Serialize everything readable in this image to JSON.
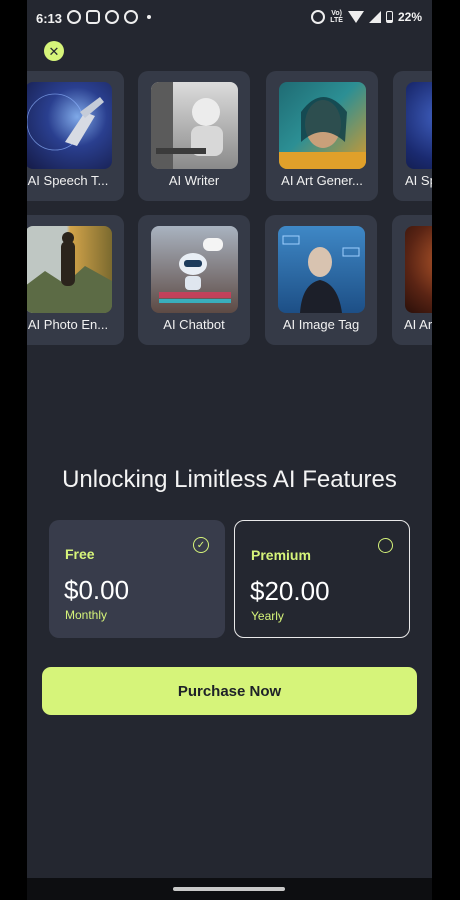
{
  "status_bar": {
    "time": "6:13",
    "left_icons": [
      "whatsapp-icon",
      "instagram-icon",
      "app-icon",
      "app-icon",
      "notification-dot"
    ],
    "network_label_top": "Vo)",
    "network_label_bottom": "LTE",
    "battery": "22%"
  },
  "close_button": {
    "icon": "close-icon",
    "glyph": "✕"
  },
  "tools_row1": [
    {
      "label": "AI Speech T...",
      "icon": "speech-robot-image"
    },
    {
      "label": "AI Writer",
      "icon": "writer-robot-image"
    },
    {
      "label": "AI Art Gener...",
      "icon": "art-portrait-image"
    },
    {
      "label": "AI Sp",
      "icon": "speech-image"
    }
  ],
  "tools_row2": [
    {
      "label": "AI Photo En...",
      "icon": "photo-enhance-image"
    },
    {
      "label": "AI Chatbot",
      "icon": "chatbot-image"
    },
    {
      "label": "AI Image Tag",
      "icon": "image-tag-image"
    },
    {
      "label": "AI Ar",
      "icon": "art-image"
    }
  ],
  "heading": "Unlocking Limitless AI Features",
  "plans": {
    "free": {
      "name": "Free",
      "price": "$0.00",
      "period": "Monthly",
      "selected": true
    },
    "premium": {
      "name": "Premium",
      "price": "$20.00",
      "period": "Yearly",
      "selected": false
    }
  },
  "purchase_button": "Purchase Now",
  "colors": {
    "accent": "#d6f47a",
    "background": "#242730",
    "card": "#353a47"
  }
}
